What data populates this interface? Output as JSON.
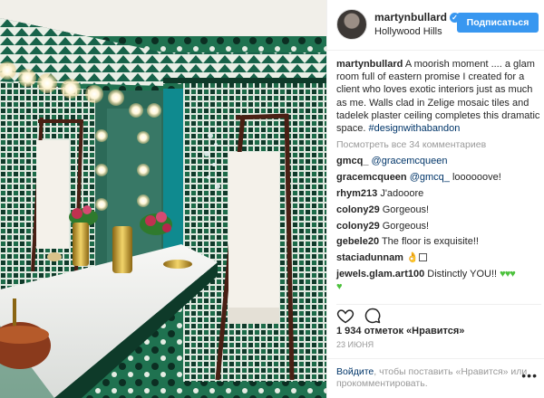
{
  "post": {
    "username": "martynbullard",
    "location": "Hollywood Hills",
    "follow_label": "Подписаться",
    "caption_text": "A moorish moment .... a glam room full of eastern promise I created for a client who loves exotic interiors just as much as me. Walls clad in Zelige mosaic tiles and tadelek plaster ceiling completes this dramatic space.",
    "caption_hashtag": "#designwithabandon",
    "view_all_comments": "Посмотреть все 34 комментариев",
    "comments": [
      {
        "user": "gmcq_",
        "text": "@gracemcqueen"
      },
      {
        "user": "gracemcqueen",
        "mention": "@gmcq_",
        "text": "loooooove!"
      },
      {
        "user": "rhym213",
        "text": "J'adooore"
      },
      {
        "user": "colony29",
        "text": "Gorgeous!"
      },
      {
        "user": "colony29",
        "text": "Gorgeous!"
      },
      {
        "user": "gebele20",
        "text": "The floor is exquisite!!"
      },
      {
        "user": "staciadunnam",
        "text": ""
      },
      {
        "user": "jewels.glam.art100",
        "text": "Distinctly YOU!!"
      }
    ],
    "likes": "1 934 отметок «Нравится»",
    "date": "23 июня",
    "login_link": "Войдите",
    "login_text": ", чтобы поставить «Нравится» или прокомментировать.",
    "more_label": "•••"
  },
  "icons": {
    "verified": "verified-badge-icon",
    "like": "heart-outline-icon",
    "comment": "comment-bubble-icon",
    "hand": "ok-hand-emoji-icon",
    "heart": "green-heart-emoji-icon"
  },
  "colors": {
    "accent": "#3897f0",
    "link": "#003569",
    "muted": "#999999",
    "text": "#262626",
    "tile_green": "#1d6b4a",
    "tile_light": "#e9efe6"
  }
}
